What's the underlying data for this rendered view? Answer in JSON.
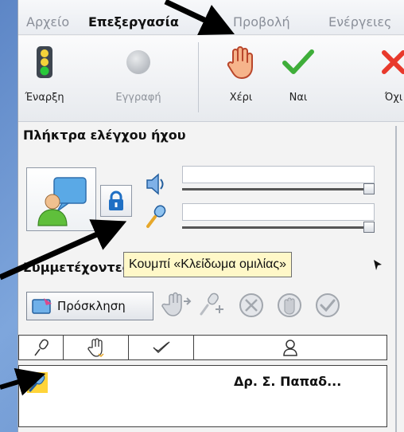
{
  "menu": {
    "items": [
      "Αρχείο",
      "Επεξεργασία",
      "Προβολή",
      "Ενέργειες"
    ]
  },
  "toolbar": {
    "start_label": "Έναρξη",
    "record_label": "Εγγραφή",
    "hand_label": "Χέρι",
    "yes_label": "Ναι",
    "no_label": "Όχι"
  },
  "audio": {
    "title": "Πλήκτρα ελέγχου ήχου",
    "speaker_level": 1.0,
    "mic_level": 1.0
  },
  "participants": {
    "title": "Συμμετέχοντες",
    "invite_label": "Πρόσκληση",
    "columns": [
      "mic-icon",
      "hand-icon",
      "check-icon",
      "person-icon"
    ],
    "rows": [
      {
        "name": "Δρ. Σ. Παπαδ..."
      }
    ]
  },
  "tooltip": {
    "text": "Κουμπί «Κλείδωμα ομιλίας»"
  },
  "colors": {
    "accent_blue": "#1f6fc4",
    "tooltip_bg": "#fff8c8",
    "arrow": "#000000"
  }
}
